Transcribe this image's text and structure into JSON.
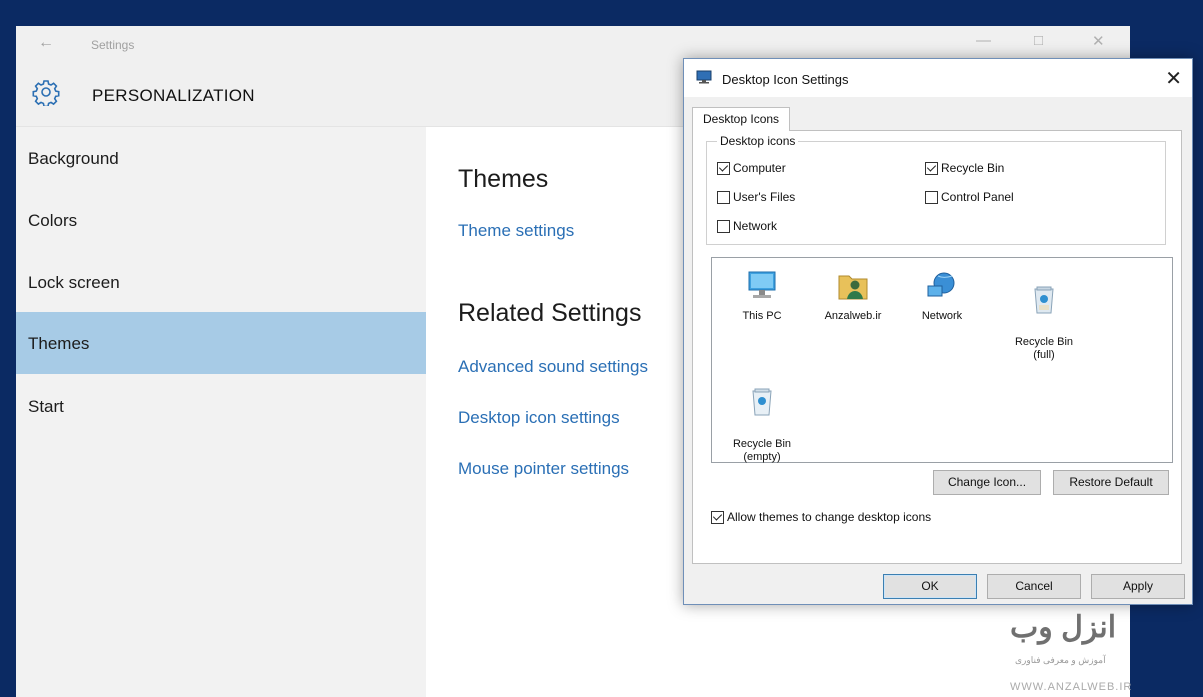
{
  "settings": {
    "title": "Settings",
    "section_title": "PERSONALIZATION",
    "nav": [
      "Background",
      "Colors",
      "Lock screen",
      "Themes",
      "Start"
    ],
    "selected_nav": "Themes",
    "themes_heading": "Themes",
    "theme_settings_link": "Theme settings",
    "related_heading": "Related Settings",
    "related_links": [
      "Advanced sound settings",
      "Desktop icon settings",
      "Mouse pointer settings"
    ],
    "accent_color": "#a7cbe6",
    "link_color": "#2a6fb5"
  },
  "dialog": {
    "title": "Desktop Icon Settings",
    "tab": "Desktop Icons",
    "group_label": "Desktop icons",
    "checkboxes": [
      {
        "label": "Computer",
        "checked": true
      },
      {
        "label": "Recycle Bin",
        "checked": true
      },
      {
        "label": "User's Files",
        "checked": false
      },
      {
        "label": "Control Panel",
        "checked": false
      },
      {
        "label": "Network",
        "checked": false
      }
    ],
    "icons": [
      {
        "label": "This PC",
        "icon": "this-pc-icon"
      },
      {
        "label": "Anzalweb.ir",
        "icon": "user-folder-icon"
      },
      {
        "label": "Network",
        "icon": "network-icon"
      },
      {
        "label": "Recycle Bin\n(full)",
        "icon": "recycle-bin-full-icon"
      },
      {
        "label": "Recycle Bin\n(empty)",
        "icon": "recycle-bin-empty-icon"
      }
    ],
    "change_icon_button": "Change Icon...",
    "restore_default_button": "Restore Default",
    "allow_themes_label": "Allow themes to change desktop icons",
    "allow_themes_checked": true,
    "ok_button": "OK",
    "cancel_button": "Cancel",
    "apply_button": "Apply"
  },
  "watermark": {
    "logo": "انزل وب",
    "tagline": "آموزش و معرفی فناوری",
    "url": "WWW.ANZALWEB.IR"
  }
}
